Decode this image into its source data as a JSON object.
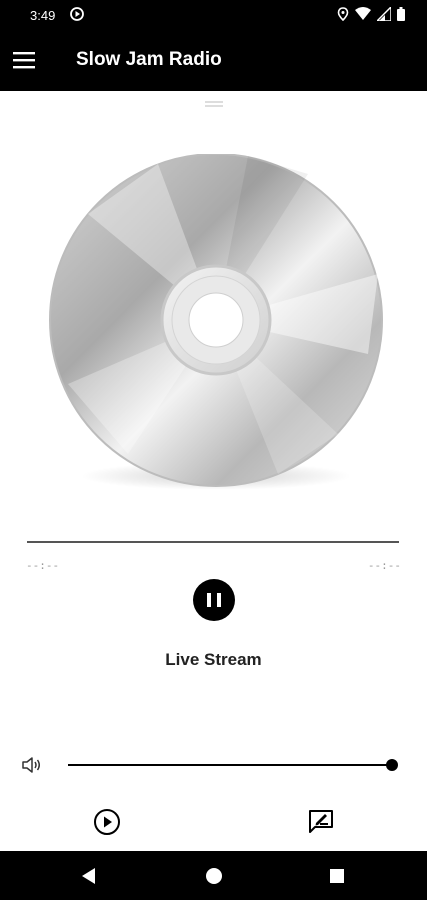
{
  "status": {
    "time": "3:49",
    "left_icon": "media-playing-icon",
    "right_icons": [
      "location-icon",
      "wifi-icon",
      "signal-icon",
      "battery-icon"
    ]
  },
  "app_bar": {
    "menu_icon": "hamburger-menu-icon",
    "title": "Slow Jam Radio"
  },
  "player": {
    "artwork_icon": "cd-disc-icon",
    "time_elapsed": "--:--",
    "time_total": "--:--",
    "state_icon": "pause-icon",
    "stream_label": "Live Stream",
    "volume_level": 1.0
  },
  "bottom_actions": [
    "play-circle-icon",
    "chat-edit-icon"
  ],
  "nav": [
    "back-icon",
    "home-icon",
    "recents-icon"
  ],
  "colors": {
    "bar": "#000000",
    "background": "#ffffff"
  }
}
